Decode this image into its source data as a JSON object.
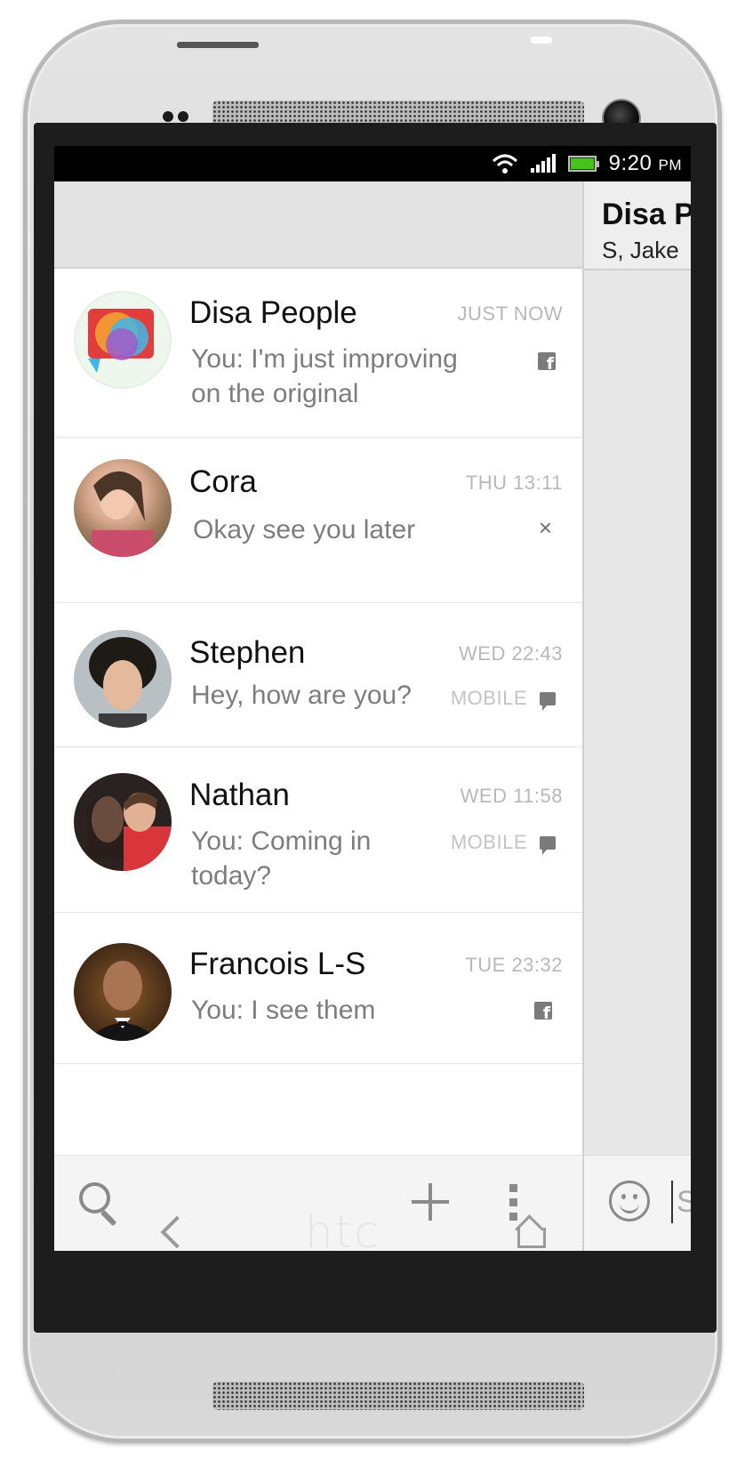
{
  "status_bar": {
    "time": "9:20",
    "ampm": "PM",
    "icons": [
      "wifi-icon",
      "signal-icon",
      "battery-icon"
    ],
    "battery_color": "#46c21a"
  },
  "conversation_pane": {
    "title": "Disa P",
    "subtitle": "S, Jake",
    "input_text": "S"
  },
  "conversations": [
    {
      "name": "Disa People",
      "time": "JUST NOW",
      "message": "You: I'm just improving on the original",
      "protocol": "",
      "service_icon": "facebook-icon"
    },
    {
      "name": "Cora",
      "time": "THU 13:11",
      "message": "Okay see you later",
      "protocol": "",
      "service_icon": "close-icon",
      "service_glyph": "×"
    },
    {
      "name": "Stephen",
      "time": "WED 22:43",
      "message": "Hey, how are you?",
      "protocol": "MOBILE",
      "service_icon": "sms-icon"
    },
    {
      "name": "Nathan",
      "time": "WED 11:58",
      "message": "You: Coming in today?",
      "protocol": "MOBILE",
      "service_icon": "sms-icon"
    },
    {
      "name": "Francois L-S",
      "time": "TUE 23:32",
      "message": "You: I see them",
      "protocol": "",
      "service_icon": "facebook-icon"
    }
  ],
  "toolbar": {
    "icons": [
      "search-icon",
      "plus-icon",
      "more-icon"
    ]
  },
  "navbar": {
    "brand": "htc",
    "icons": [
      "back-icon",
      "home-icon"
    ]
  }
}
